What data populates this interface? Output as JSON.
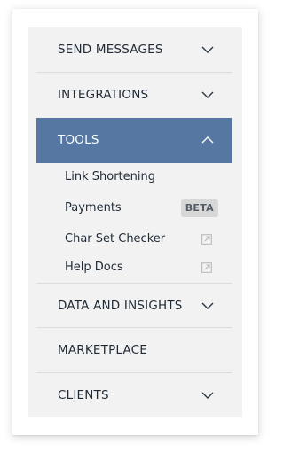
{
  "menu": {
    "send_messages": "SEND MESSAGES",
    "integrations": "INTEGRATIONS",
    "tools": "TOOLS",
    "tools_items": {
      "link_shortening": "Link Shortening",
      "payments": "Payments",
      "payments_badge": "BETA",
      "char_set_checker": "Char Set Checker",
      "help_docs": "Help Docs"
    },
    "data_and_insights": "DATA AND INSIGHTS",
    "marketplace": "MARKETPLACE",
    "clients": "CLIENTS"
  },
  "colors": {
    "active_bg": "#5577a2",
    "panel_bg": "#f2f2f2",
    "text": "#1f2a36"
  },
  "icons": {
    "expand": "chevron-down-icon",
    "collapse": "chevron-up-icon",
    "external": "external-link-icon"
  }
}
